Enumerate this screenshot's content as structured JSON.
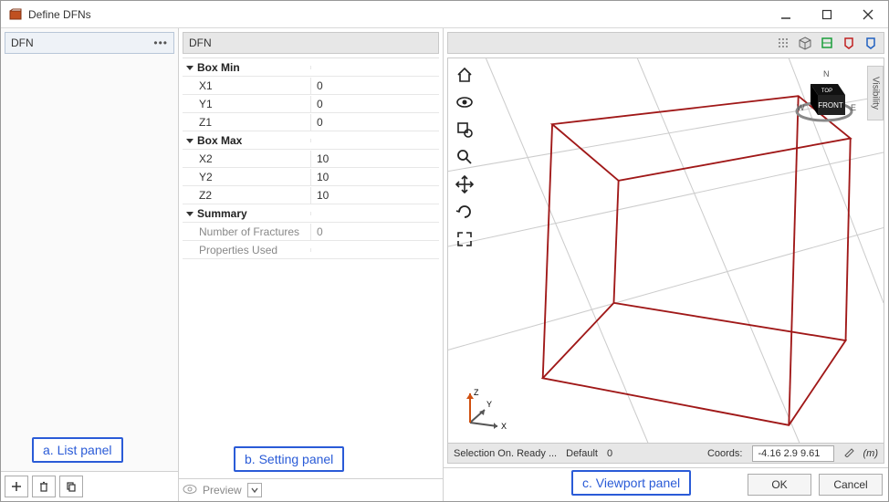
{
  "window": {
    "title": "Define DFNs"
  },
  "list": {
    "item_label": "DFN"
  },
  "settings": {
    "header": "DFN",
    "preview_label": "Preview",
    "sections": {
      "box_min": {
        "label": "Box Min",
        "rows": [
          {
            "k": "X1",
            "v": "0"
          },
          {
            "k": "Y1",
            "v": "0"
          },
          {
            "k": "Z1",
            "v": "0"
          }
        ]
      },
      "box_max": {
        "label": "Box Max",
        "rows": [
          {
            "k": "X2",
            "v": "10"
          },
          {
            "k": "Y2",
            "v": "10"
          },
          {
            "k": "Z2",
            "v": "10"
          }
        ]
      },
      "summary": {
        "label": "Summary",
        "rows": [
          {
            "k": "Number of Fractures",
            "v": "0"
          },
          {
            "k": "Properties Used",
            "v": ""
          }
        ]
      }
    }
  },
  "viewport": {
    "visibility_label": "Visibility",
    "status_selection": "Selection On. Ready ...",
    "status_default": "Default",
    "status_count": "0",
    "coords_label": "Coords:",
    "coords_value": "-4.16 2.9 9.61",
    "unit_label": "(m)",
    "cube_front": "FRONT",
    "cube_top": "TOP",
    "axes": {
      "x": "X",
      "y": "Y",
      "z": "Z"
    }
  },
  "annotations": {
    "a": "a. List panel",
    "b": "b. Setting panel",
    "c": "c. Viewport panel"
  },
  "buttons": {
    "ok": "OK",
    "cancel": "Cancel"
  },
  "colors": {
    "accent": "#2a5bd7",
    "wire": "#a01818"
  }
}
